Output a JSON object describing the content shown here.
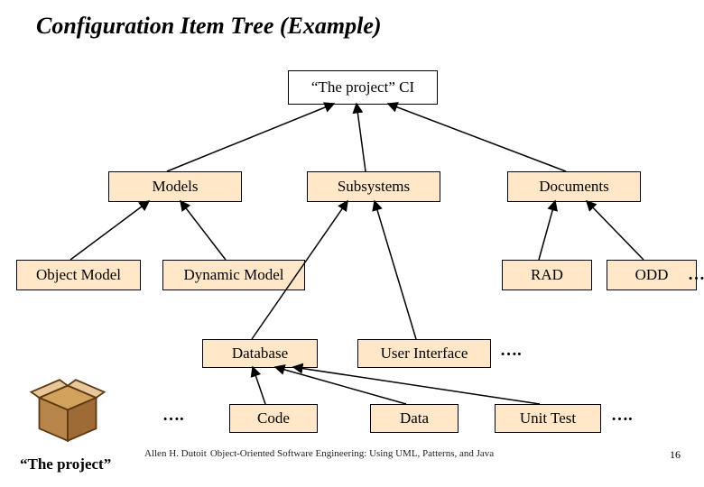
{
  "title": "Configuration Item Tree (Example)",
  "root": {
    "label": "“The project” CI"
  },
  "level1": {
    "models": "Models",
    "subsystems": "Subsystems",
    "documents": "Documents"
  },
  "level2": {
    "object_model": "Object Model",
    "dynamic_model": "Dynamic Model",
    "rad": "RAD",
    "odd": "ODD"
  },
  "level3": {
    "database": "Database",
    "user_interface": "User Interface"
  },
  "level4": {
    "code": "Code",
    "data": "Data",
    "unit_test": "Unit Test"
  },
  "ellipsis": "….",
  "project_label": "“The project”",
  "footer_author": "Allen H. Dutoit",
  "footer_book": "Object-Oriented Software Engineering: Using UML, Patterns, and Java",
  "page_number": "16",
  "colors": {
    "box_fill": "#ffe7c8"
  }
}
